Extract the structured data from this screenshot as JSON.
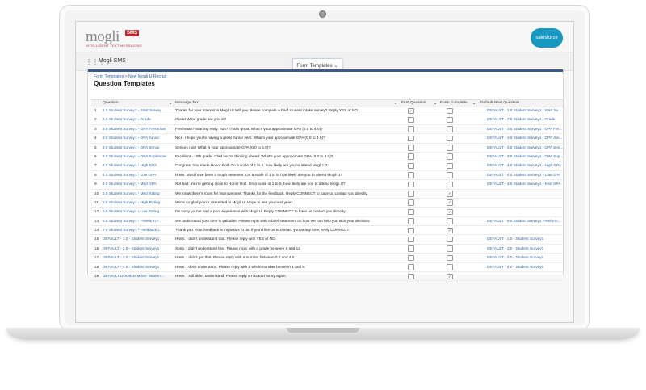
{
  "brand": {
    "logo": "mogli",
    "logo_badge": "SMS",
    "tagline": "INTELLIGENT TEXT MESSAGING",
    "partner": "salesforce"
  },
  "appbar": {
    "app_name": "Mogli SMS",
    "active_tab": "Form Templates"
  },
  "page": {
    "breadcrumb": "Form Templates > New Mogli U Recruit",
    "title": "Question Templates"
  },
  "table": {
    "headers": [
      "Question",
      "Message Text",
      "First Question",
      "Form Complete",
      "Default Next Question"
    ],
    "rows": [
      {
        "n": "1",
        "q": "1.0 Student Survey1 - Start Survey",
        "msg": "Thanks for your interest in Mogli U! Will you please complete a brief student intake survey? Reply YES or NO",
        "fq": true,
        "fc": false,
        "dn": "DEFAULT - 1.0 Student Survey1 - Start Su..."
      },
      {
        "n": "2",
        "q": "2.0 Student Survey1 - Grade",
        "msg": "Great! What grade are you in?",
        "fq": false,
        "fc": false,
        "dn": "DEFAULT - 2.0 Student Survey1 - Grade"
      },
      {
        "n": "3",
        "q": "3.0 Student Survey1 - GPA Freshman",
        "msg": "Freshman? Starting early, huh? That's great. What's your approximate GPA (0.0 to 4.0)?",
        "fq": false,
        "fc": false,
        "dn": "DEFAULT - 3.0 Student Survey1 - GPA Fre..."
      },
      {
        "n": "4",
        "q": "3.0 Student Survey1 - GPA Junior",
        "msg": "Nice. I hope you're having a great Junior year. What's your approximate GPA (0.0 to 4.0)?",
        "fq": false,
        "fc": false,
        "dn": "DEFAULT - 3.0 Student Survey1 - GPA Jun..."
      },
      {
        "n": "5",
        "q": "3.0 Student Survey1 - GPA Senior",
        "msg": "Seniors rule! What is your approximate GPA (0.0 to 4.0)?",
        "fq": false,
        "fc": false,
        "dn": "DEFAULT - 3.0 Student Survey1 - GPA Sen..."
      },
      {
        "n": "6",
        "q": "3.0 Student Survey1 - GPA Sophmore",
        "msg": "Excellent - 10th grade. Glad you're thinking ahead. What's your approximate GPA (0.0 to 4.0)?",
        "fq": false,
        "fc": false,
        "dn": "DEFAULT - 3.0 Student Survey1 - GPA Sop..."
      },
      {
        "n": "7",
        "q": "4.0 Student Survey1 - High GPA",
        "msg": "Congrats! You made Honor Roll! On a scale of 1 to 5, how likely are you to attend Mogli U?",
        "fq": false,
        "fc": false,
        "dn": "DEFAULT - 4.0 Student Survey1 - High GPA"
      },
      {
        "n": "8",
        "q": "4.0 Student Survey1 - Low GPA",
        "msg": "Hmm. Must have been a tough semester. On a scale of 1 to 5, how likely are you to attend Mogli U?",
        "fq": false,
        "fc": false,
        "dn": "DEFAULT - 4.0 Student Survey1 - Low GPA"
      },
      {
        "n": "9",
        "q": "4.0 Student Survey1 - Med GPA",
        "msg": "Not bad. You're getting close to Honor Roll. On a scale of 1 to 5, how likely are you to attend Mogli U?",
        "fq": false,
        "fc": false,
        "dn": "DEFAULT - 4.0 Student Survey1 - Med GPA"
      },
      {
        "n": "10",
        "q": "5.0 Student Survey1 - Med Rating",
        "msg": "We know there's room for improvement. Thanks for the feedback. Reply CONNECT to have us contact you directly.",
        "fq": false,
        "fc": true,
        "dn": ""
      },
      {
        "n": "11",
        "q": "5.0 Student Survey1 - High Rating",
        "msg": "We're so glad you're interested in Mogli U. Hope to see you next year!",
        "fq": false,
        "fc": true,
        "dn": ""
      },
      {
        "n": "12",
        "q": "5.0 Student Survey1 - Low Rating",
        "msg": "I'm sorry you've had a poor experience with Mogli U. Reply CONNECT to have us contact you directly.",
        "fq": false,
        "fc": true,
        "dn": ""
      },
      {
        "n": "13",
        "q": "6.0 Student Survey1 - Freeform F...",
        "msg": "We understand your time is valuable. Please reply with a brief statement on how we can help you with your decision.",
        "fq": false,
        "fc": false,
        "dn": "DEFAULT - 6.0 Student Survey1 Freeform..."
      },
      {
        "n": "14",
        "q": "7.0 Student Survey1 - Feedback I...",
        "msg": "Thank you. Your feedback is important to us. If you'd like us to contact you at any time, reply CONNECT.",
        "fq": false,
        "fc": true,
        "dn": ""
      },
      {
        "n": "15",
        "q": "DEFAULT - 1.0 - Student Survey1",
        "msg": "Hmm. I didn't understand that. Please reply with YES or NO.",
        "fq": false,
        "fc": false,
        "dn": "DEFAULT - 1.0 - Student Survey1"
      },
      {
        "n": "16",
        "q": "DEFAULT - 2.0 - Student Survey1",
        "msg": "Sorry. I didn't understand that. Please reply with a grade between 9 and 12.",
        "fq": false,
        "fc": false,
        "dn": "DEFAULT - 2.0 - Student Survey1"
      },
      {
        "n": "17",
        "q": "DEFAULT - 3.0 - Student Survey1",
        "msg": "Hmm. I didn't get that. Please reply with a number between 0.0 and 4.0.",
        "fq": false,
        "fc": false,
        "dn": "DEFAULT - 3.0 - Student Survey1"
      },
      {
        "n": "18",
        "q": "DEFAULT - 4.0 - Student Survey1",
        "msg": "Hmm. I don't understand. Please reply with a whole number between 1 and 5.",
        "fq": false,
        "fc": false,
        "dn": "DEFAULT - 4.0 - Student Survey1"
      },
      {
        "n": "19",
        "q": "DEFAULT DOUBLE MISS- Student...",
        "msg": "Hmm. I still didn't understand. Please reply STUDENT to try again.",
        "fq": false,
        "fc": true,
        "dn": ""
      }
    ]
  }
}
